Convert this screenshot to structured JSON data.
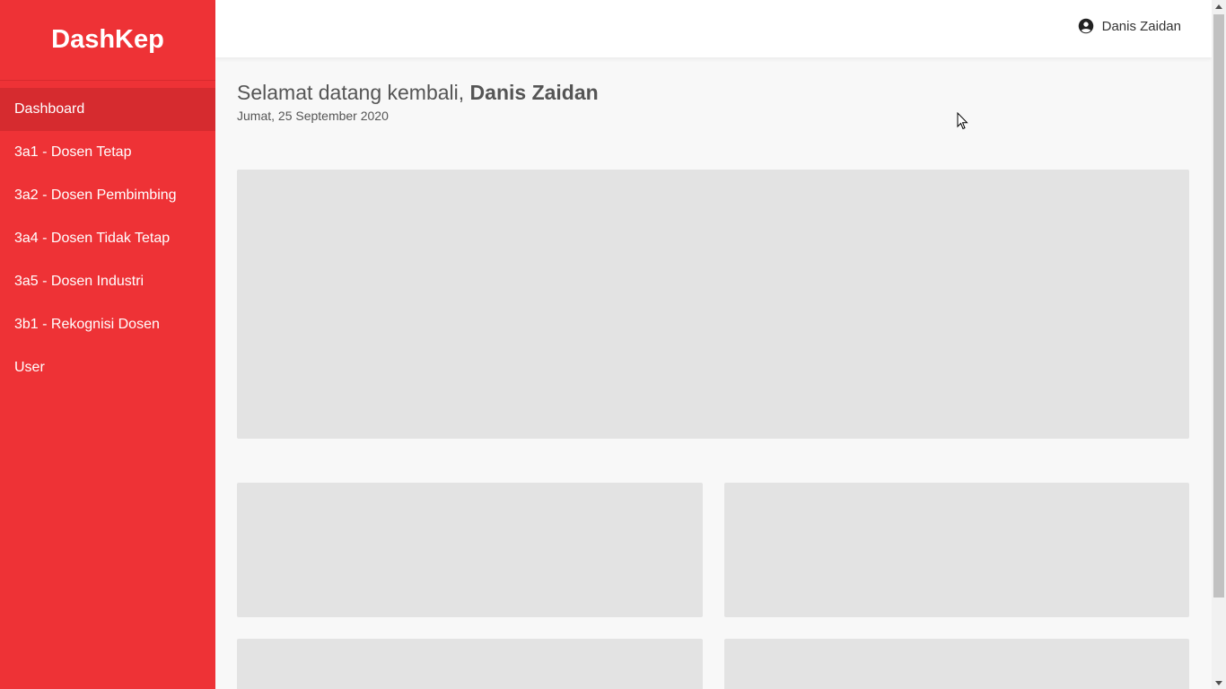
{
  "brand": "DashKep",
  "sidebar": {
    "items": [
      {
        "label": "Dashboard",
        "active": true
      },
      {
        "label": "3a1 - Dosen Tetap"
      },
      {
        "label": "3a2 - Dosen Pembimbing"
      },
      {
        "label": "3a4 - Dosen Tidak Tetap"
      },
      {
        "label": "3a5 - Dosen Industri"
      },
      {
        "label": "3b1 - Rekognisi Dosen"
      },
      {
        "label": "User"
      }
    ]
  },
  "header": {
    "user_name": "Danis Zaidan",
    "user_icon": "account-circle-icon"
  },
  "main": {
    "greeting_prefix": "Selamat datang kembali, ",
    "greeting_name": "Danis Zaidan",
    "date": "Jumat, 25 September 2020"
  },
  "colors": {
    "sidebar_bg": "#ee3236",
    "sidebar_active": "#d62b2f",
    "content_bg": "#f8f8f8",
    "placeholder": "#e3e3e3"
  }
}
